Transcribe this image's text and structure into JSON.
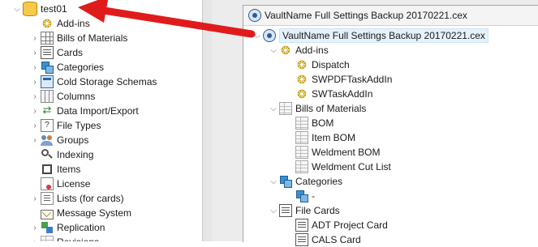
{
  "left_tree": {
    "root": {
      "label": "test01",
      "icon": "database-icon",
      "expanded": true
    },
    "items": [
      {
        "label": "Add-ins",
        "icon": "puzzle-icon",
        "expandable": false
      },
      {
        "label": "Bills of Materials",
        "icon": "bom-grid-icon",
        "expandable": true
      },
      {
        "label": "Cards",
        "icon": "card-icon",
        "expandable": true
      },
      {
        "label": "Categories",
        "icon": "categories-icon",
        "expandable": true
      },
      {
        "label": "Cold Storage Schemas",
        "icon": "cold-storage-icon",
        "expandable": true
      },
      {
        "label": "Columns",
        "icon": "columns-icon",
        "expandable": true
      },
      {
        "label": "Data Import/Export",
        "icon": "import-export-icon",
        "expandable": true
      },
      {
        "label": "File Types",
        "icon": "file-types-icon",
        "expandable": true
      },
      {
        "label": "Groups",
        "icon": "groups-icon",
        "expandable": true
      },
      {
        "label": "Indexing",
        "icon": "indexing-icon",
        "expandable": false
      },
      {
        "label": "Items",
        "icon": "items-icon",
        "expandable": false
      },
      {
        "label": "License",
        "icon": "license-icon",
        "expandable": false
      },
      {
        "label": "Lists (for cards)",
        "icon": "lists-icon",
        "expandable": true
      },
      {
        "label": "Message System",
        "icon": "message-icon",
        "expandable": false
      },
      {
        "label": "Replication",
        "icon": "replication-icon",
        "expandable": true
      },
      {
        "label": "Revisions",
        "icon": "revisions-icon",
        "expandable": true
      }
    ]
  },
  "backup_window": {
    "title": "VaultName Full Settings Backup 20170221.cex",
    "tree": {
      "root": "VaultName Full Settings Backup 20170221.cex",
      "addins": {
        "label": "Add-ins",
        "children": [
          "Dispatch",
          "SWPDFTaskAddIn",
          "SWTaskAddIn"
        ]
      },
      "boms": {
        "label": "Bills of Materials",
        "children": [
          "BOM",
          "Item BOM",
          "Weldment BOM",
          "Weldment Cut List"
        ]
      },
      "categories": {
        "label": "Categories",
        "children": [
          "-"
        ]
      },
      "file_cards": {
        "label": "File Cards",
        "children": [
          "ADT Project Card",
          "CALS Card"
        ]
      }
    }
  },
  "colors": {
    "arrow": "#e01b1b",
    "selection_fill": "#e5f1fb",
    "panel_background": "#ececec"
  }
}
